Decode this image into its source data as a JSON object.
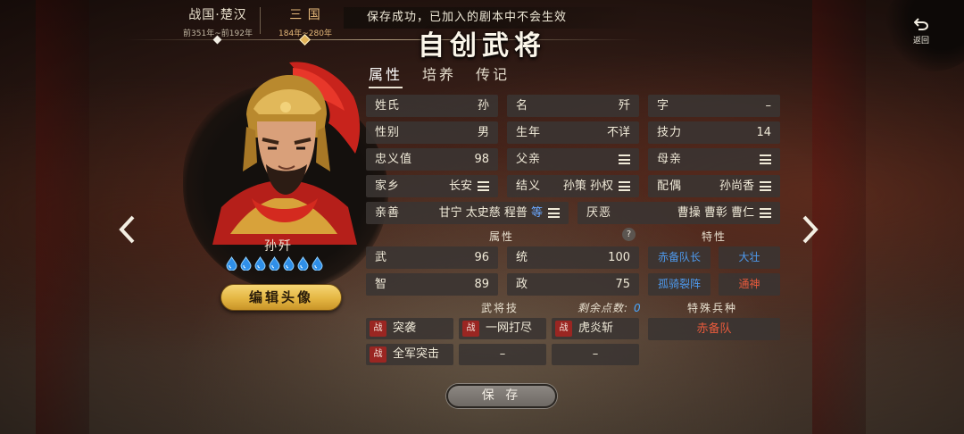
{
  "eras": [
    {
      "name": "战国·楚汉",
      "range": "前351年~前192年"
    },
    {
      "name": "三 国",
      "range": "184年~280年"
    }
  ],
  "toast": "保存成功，已加入的剧本中不会生效",
  "title": "自创武将",
  "back_label": "返回",
  "tabs": [
    "属性",
    "培养",
    "传记"
  ],
  "hero": {
    "name": "孙歼",
    "soul_drops": 7,
    "edit_avatar_label": "编辑头像"
  },
  "info": {
    "surname": {
      "label": "姓氏",
      "value": "孙"
    },
    "given": {
      "label": "名",
      "value": "歼"
    },
    "style": {
      "label": "字",
      "value": "–"
    },
    "gender": {
      "label": "性别",
      "value": "男"
    },
    "birth": {
      "label": "生年",
      "value": "不详"
    },
    "skill_power": {
      "label": "技力",
      "value": "14"
    },
    "loyalty": {
      "label": "忠义值",
      "value": "98"
    },
    "father": {
      "label": "父亲",
      "value": ""
    },
    "mother": {
      "label": "母亲",
      "value": ""
    },
    "hometown": {
      "label": "家乡",
      "value": "长安"
    },
    "sworn": {
      "label": "结义",
      "value": "孙策 孙权"
    },
    "spouse": {
      "label": "配偶",
      "value": "孙尚香"
    },
    "friends": {
      "label": "亲善",
      "value": "甘宁 太史慈 程普",
      "more": "等"
    },
    "enemies": {
      "label": "厌恶",
      "value": "曹操 曹彰 曹仁"
    }
  },
  "attributes": {
    "heading": "属性",
    "help": "?",
    "war": {
      "label": "武",
      "value": "96"
    },
    "command": {
      "label": "统",
      "value": "100"
    },
    "intel": {
      "label": "智",
      "value": "89"
    },
    "politics": {
      "label": "政",
      "value": "75"
    }
  },
  "traits": {
    "heading": "特性",
    "items": [
      {
        "label": "赤备队长",
        "color": "#4e9aee"
      },
      {
        "label": "大壮",
        "color": "#4e9aee"
      },
      {
        "label": "孤骑裂阵",
        "color": "#4e9aee"
      },
      {
        "label": "通神",
        "color": "#e75a3c"
      }
    ]
  },
  "skills": {
    "heading": "武将技",
    "remaining_label": "剩余点数:",
    "remaining": "0",
    "badge": "战",
    "items": [
      "突袭",
      "一网打尽",
      "虎炎斩",
      "全军突击"
    ],
    "empty": [
      "–",
      "–"
    ]
  },
  "special_troop": {
    "heading": "特殊兵种",
    "value": "赤备队"
  },
  "save_label": "保 存"
}
